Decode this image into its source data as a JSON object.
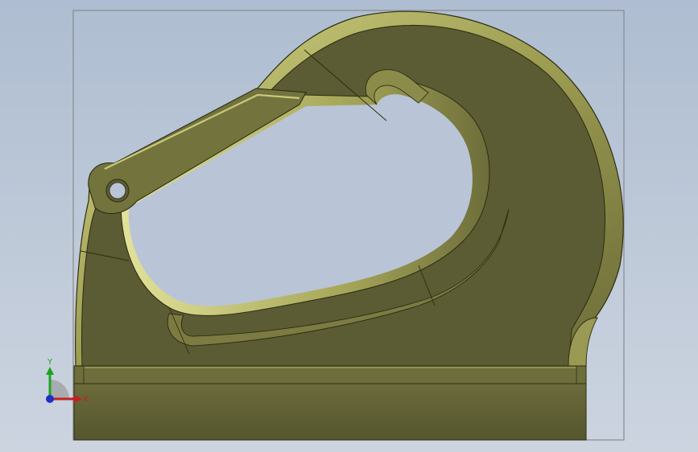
{
  "viewport": {
    "background_top": "#aebdd1",
    "background_bottom": "#ccd4e0"
  },
  "model": {
    "name": "hook-part",
    "body_color": "#5b5b34",
    "highlight_color": "#c9c97a",
    "edge_color": "#2d2d12",
    "bounding_frame_color": "#8a8a8a"
  },
  "triad": {
    "y_label": "Y",
    "x_label": "X",
    "y_color": "#1fa31f",
    "x_color": "#c81e1e",
    "z_color": "#1e2fc8"
  }
}
